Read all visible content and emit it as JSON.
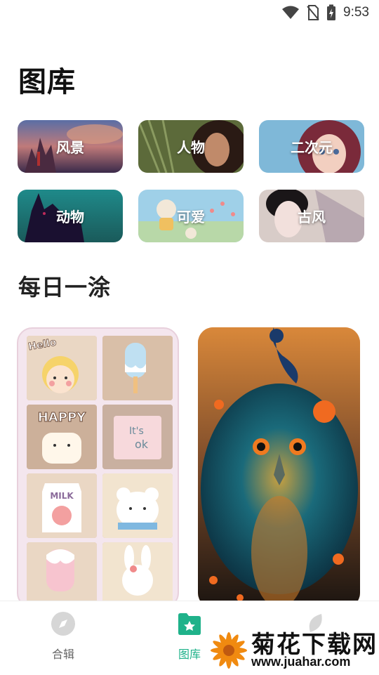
{
  "status_bar": {
    "time": "9:53",
    "icons": [
      "wifi-icon",
      "no-sim-icon",
      "battery-charging-icon"
    ]
  },
  "page_title": "图库",
  "categories": [
    {
      "label": "风景"
    },
    {
      "label": "人物"
    },
    {
      "label": "二次元"
    },
    {
      "label": "动物"
    },
    {
      "label": "可爱"
    },
    {
      "label": "古风"
    }
  ],
  "daily_section": {
    "title": "每日一涂",
    "cards": [
      {
        "texts": [
          "Hello",
          "HAPPY",
          "It's",
          "ok",
          "MILK"
        ]
      },
      {}
    ]
  },
  "bottom_nav": {
    "items": [
      {
        "label": "合辑",
        "icon": "compass-icon",
        "active": false
      },
      {
        "label": "图库",
        "icon": "gallery-folder-icon",
        "active": true
      },
      {
        "label": "",
        "icon": "leaf-icon",
        "active": false
      }
    ]
  },
  "watermark": {
    "text": "菊花下载网",
    "url": "www.juahar.com"
  },
  "colors": {
    "accent": "#1fb28a",
    "title": "#111111",
    "nav_inactive": "#666666"
  }
}
